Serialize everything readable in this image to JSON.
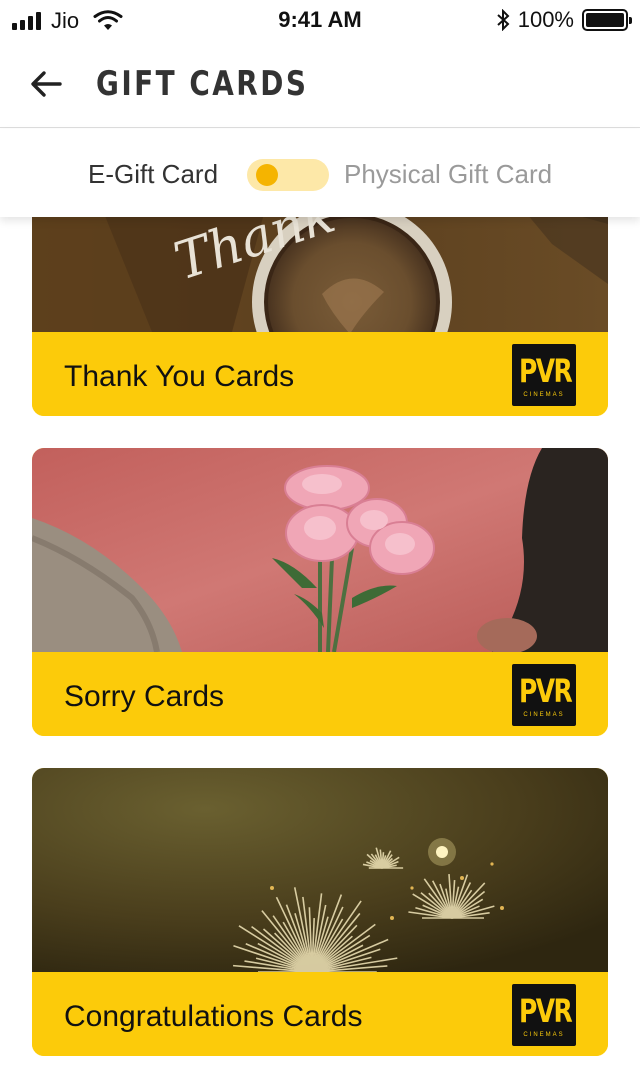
{
  "status_bar": {
    "carrier": "Jio",
    "time": "9:41 AM",
    "battery": "100%"
  },
  "header": {
    "title": "GIFT CARDS",
    "back_icon": "arrow-left-icon"
  },
  "toggle": {
    "left_label": "E-Gift Card",
    "right_label": "Physical Gift Card",
    "selected": "E-Gift Card"
  },
  "cards": [
    {
      "label": "Thank You Cards",
      "image_text": "Thank",
      "logo": {
        "main": "PVR",
        "sub": "CINEMAS"
      }
    },
    {
      "label": "Sorry Cards",
      "logo": {
        "main": "PVR",
        "sub": "CINEMAS"
      }
    },
    {
      "label": "Congratulations Cards",
      "logo": {
        "main": "PVR",
        "sub": "CINEMAS"
      }
    }
  ],
  "colors": {
    "accent": "#fccb0a",
    "toggle_track": "#fde8a8",
    "toggle_knob": "#f5b400"
  }
}
